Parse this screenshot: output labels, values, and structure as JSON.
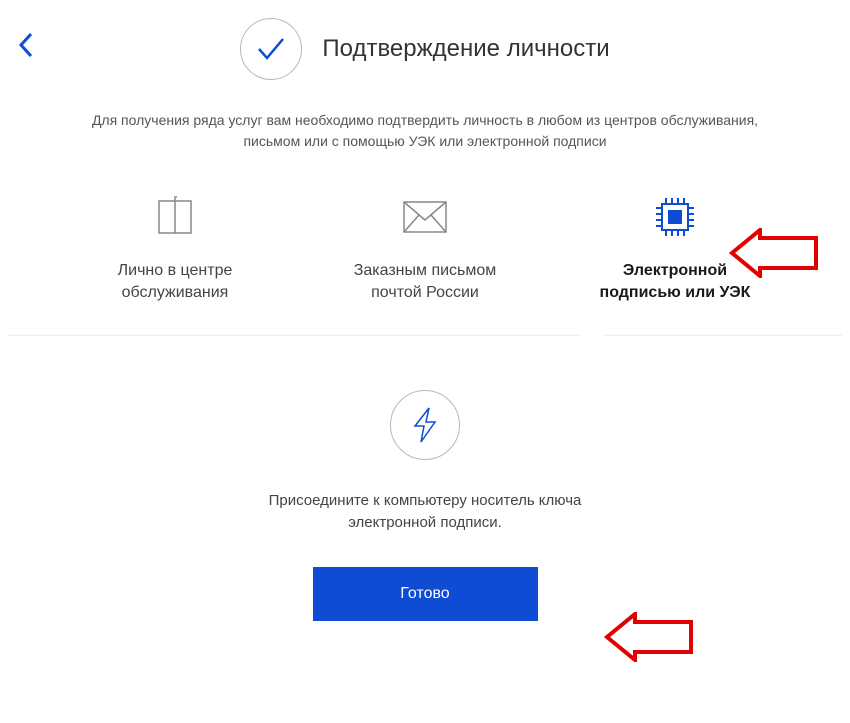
{
  "header": {
    "title": "Подтверждение личности"
  },
  "description": {
    "line1": "Для получения ряда услуг вам необходимо подтвердить личность в любом из центров обслуживания,",
    "line2": "письмом или с помощью УЭК или электронной подписи"
  },
  "options": [
    {
      "label_line1": "Лично в центре",
      "label_line2": "обслуживания",
      "active": false
    },
    {
      "label_line1": "Заказным письмом",
      "label_line2": "почтой России",
      "active": false
    },
    {
      "label_line1": "Электронной",
      "label_line2": "подписью или УЭК",
      "active": true
    }
  ],
  "panel": {
    "text_line1": "Присоедините к компьютеру носитель ключа",
    "text_line2": "электронной подписи.",
    "button_label": "Готово"
  },
  "colors": {
    "primary": "#0d4cd3",
    "accent_red": "#e30000"
  }
}
